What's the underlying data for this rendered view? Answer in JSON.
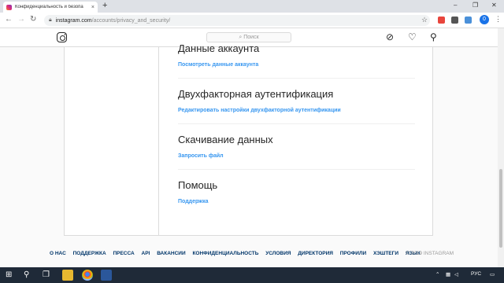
{
  "browser": {
    "tab_title": "Конфиденциальность и безопа",
    "tab_close": "×",
    "new_tab": "+",
    "url_host": "instagram.com",
    "url_path": "/accounts/privacy_and_security/",
    "profile_letter": "0"
  },
  "ig": {
    "search_placeholder": "Поиск",
    "search_icon": "search-icon"
  },
  "sections": [
    {
      "title": "Данные аккаунта",
      "link": "Посмотреть данные аккаунта"
    },
    {
      "title": "Двухфакторная аутентификация",
      "link": "Редактировать настройки двухфакторной аутентификации"
    },
    {
      "title": "Скачивание данных",
      "link": "Запросить файл"
    },
    {
      "title": "Помощь",
      "link": "Поддержка"
    }
  ],
  "footer": {
    "links": [
      "О НАС",
      "ПОДДЕРЖКА",
      "ПРЕССА",
      "API",
      "ВАКАНСИИ",
      "КОНФИДЕНЦИАЛЬНОСТЬ",
      "УСЛОВИЯ",
      "ДИРЕКТОРИЯ",
      "ПРОФИЛИ",
      "ХЭШТЕГИ",
      "ЯЗЫК"
    ],
    "copyright": "© 2019 INSTAGRAM"
  },
  "taskbar": {
    "lang": "РУС"
  },
  "colors": {
    "link": "#3897f0",
    "footer_link": "#003569",
    "taskbar": "#1f2a38"
  }
}
